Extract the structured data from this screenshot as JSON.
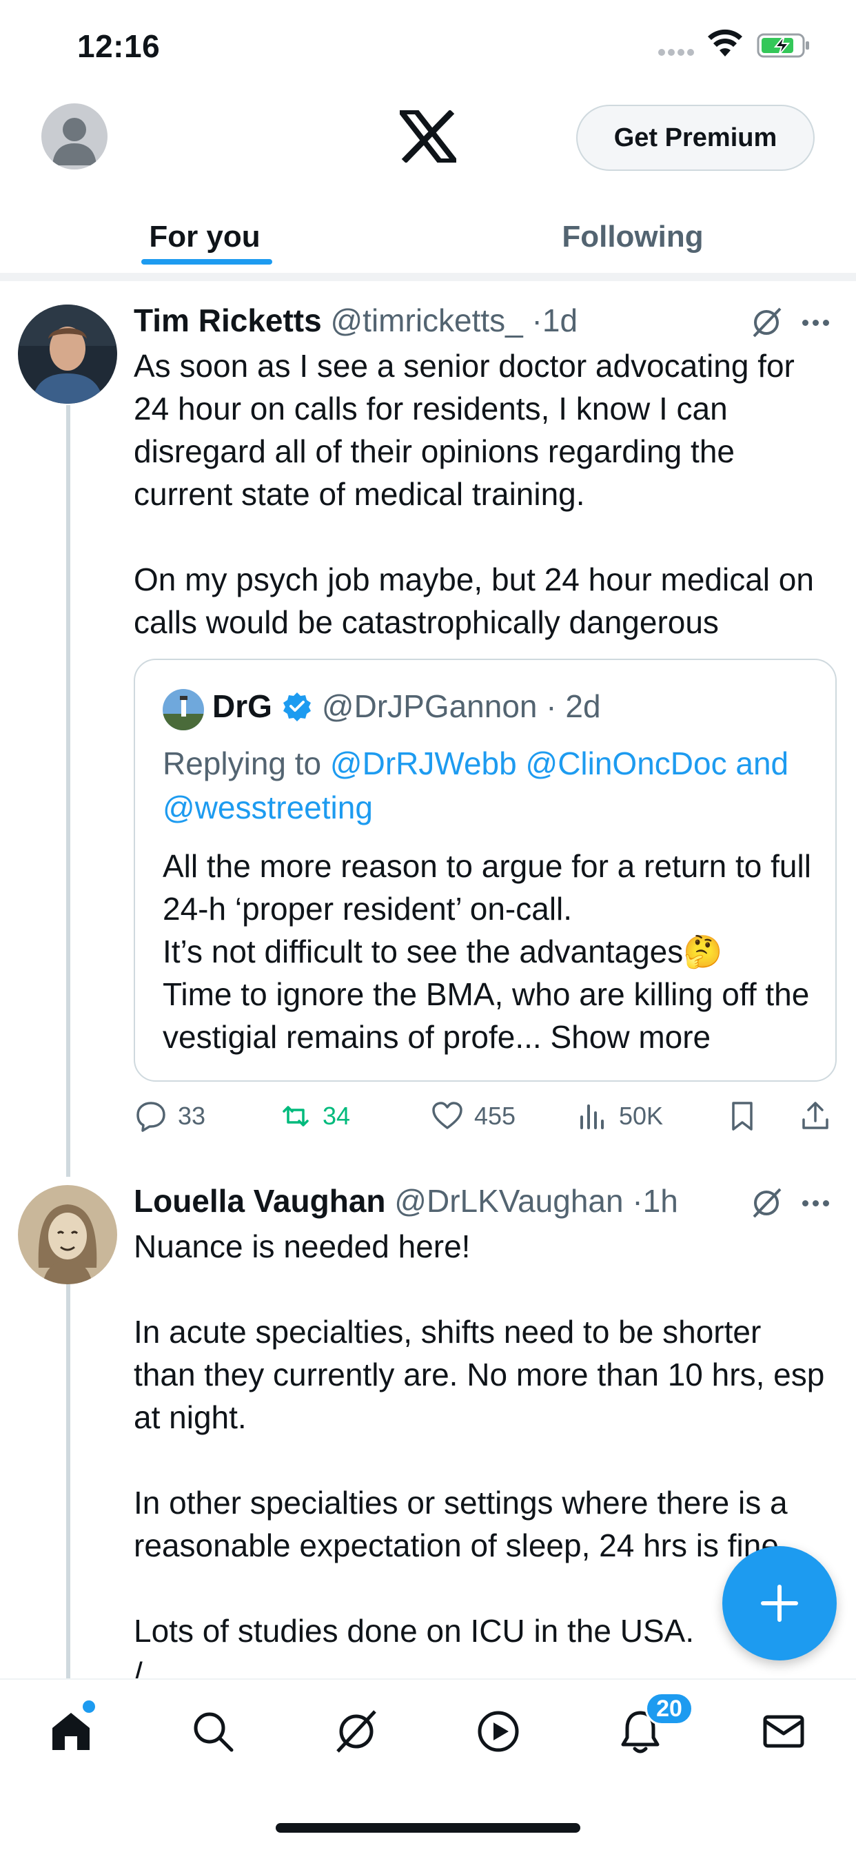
{
  "status_bar": {
    "time": "12:16"
  },
  "header": {
    "premium_label": "Get Premium",
    "tabs": [
      {
        "label": "For you",
        "selected": true
      },
      {
        "label": "Following",
        "selected": false
      }
    ]
  },
  "tweets": [
    {
      "name": "Tim Ricketts",
      "handle": "@timricketts_",
      "time": "1d",
      "text": "As soon as I see a senior doctor advocating for 24 hour on calls for residents, I know I can disregard all of their opinions regarding the current state of medical training.\n\nOn my psych job maybe, but 24 hour medical on calls would be catastrophically dangerous",
      "quote": {
        "name": "DrG",
        "handle": "@DrJPGannon",
        "time": "2d",
        "replying_prefix": "Replying to ",
        "replying_to": "@DrRJWebb @ClinOncDoc and @wesstreeting",
        "text": "All the more reason to argue for a return to full 24-h ‘proper resident’ on-call.\nIt’s not difficult to see the advantages🤔\nTime to ignore the BMA, who are killing off the vestigial remains of profe...",
        "show_more": "Show more"
      },
      "stats": {
        "replies": "33",
        "reposts": "34",
        "likes": "455",
        "views": "50K"
      }
    },
    {
      "name": "Louella Vaughan",
      "handle": "@DrLKVaughan",
      "time": "1h",
      "text": "Nuance is needed here!\n\nIn acute specialties, shifts need to be shorter than they currently are. No more than 10 hrs, esp at night.\n\nIn other specialties or settings where there is a reasonable expectation of sleep, 24 hrs is fine.\n\nLots of studies done on ICU in the USA.\n/"
    }
  ],
  "bottom_nav": {
    "notifications_badge": "20"
  },
  "colors": {
    "accent": "#1d9bf0",
    "repost_green": "#00ba7c",
    "muted": "#536471"
  }
}
